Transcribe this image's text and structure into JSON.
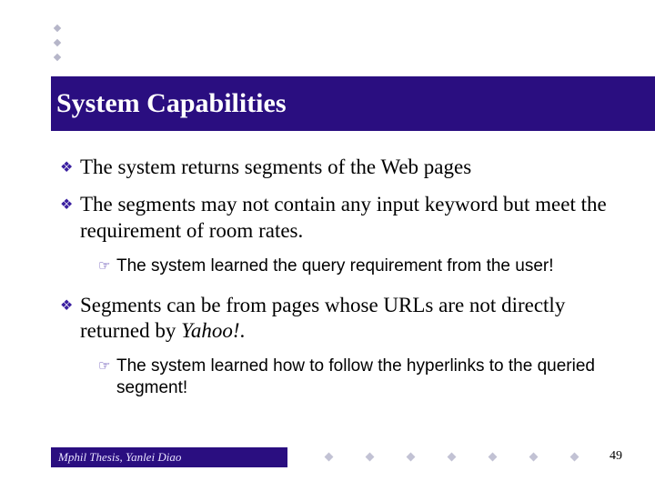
{
  "title": "System Capabilities",
  "bullets": {
    "b1": "The system returns segments of the Web pages",
    "b2": "The segments may not contain any input keyword but meet the requirement of room rates.",
    "b2_sub": "The system learned the query requirement from the user!",
    "b3_pre": "Segments can be from pages whose URLs are not directly returned by ",
    "b3_em": "Yahoo!",
    "b3_post": ".",
    "b3_sub": "The system learned how to follow the hyperlinks to the queried segment!"
  },
  "footer": "Mphil Thesis, Yanlei Diao",
  "page_number": "49",
  "icons": {
    "diamond": "❖",
    "hand": "☞"
  }
}
